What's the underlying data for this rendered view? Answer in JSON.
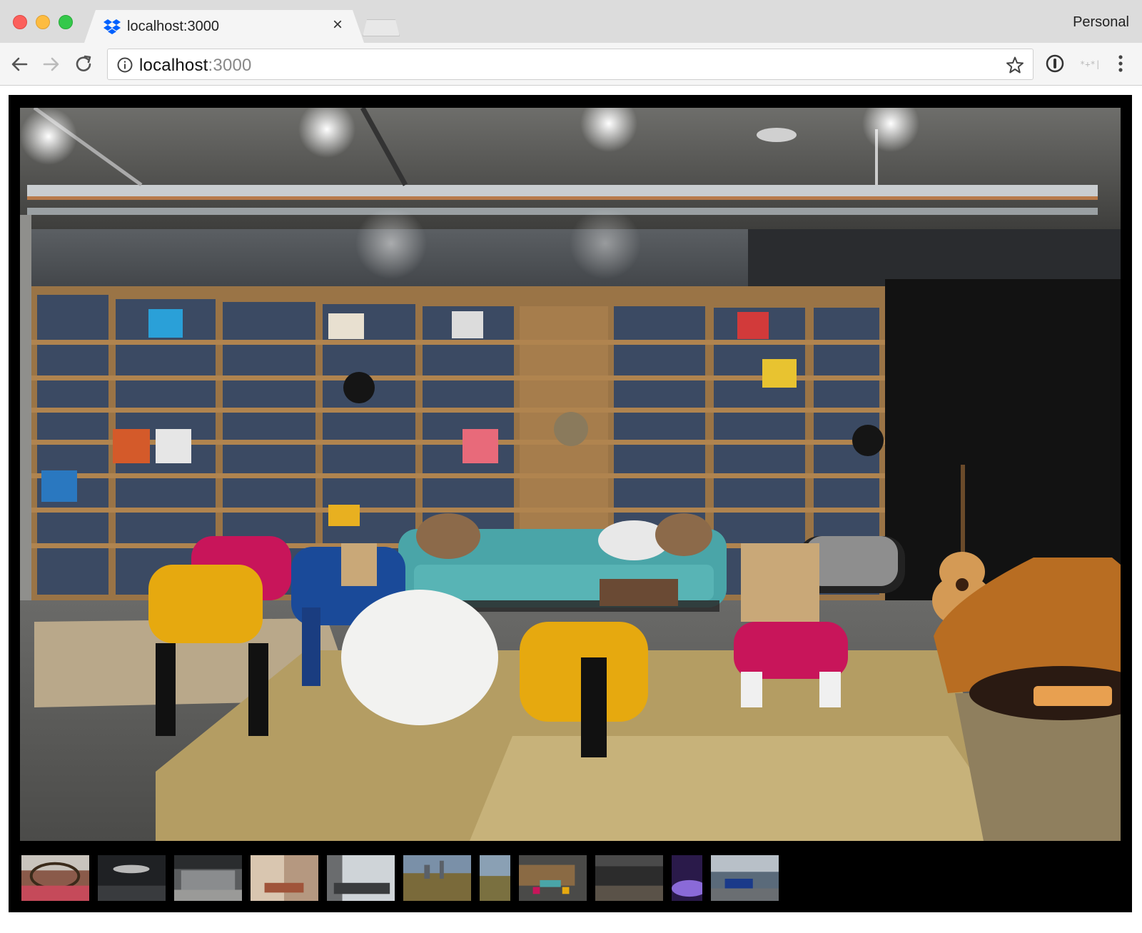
{
  "browser": {
    "tab": {
      "title": "localhost:3000",
      "favicon": "dropbox-icon",
      "close_glyph": "×"
    },
    "profile_label": "Personal",
    "toolbar": {
      "back_icon": "arrow-left-icon",
      "forward_icon": "arrow-right-icon",
      "reload_icon": "reload-icon",
      "url_host": "localhost",
      "url_port": ":3000",
      "info_icon": "info-icon",
      "bookmark_icon": "star-icon",
      "extensions": [
        "password-manager-icon",
        "extension-icon",
        "menu-dots-icon"
      ]
    }
  },
  "gallery": {
    "main_image": {
      "description_icon": "photo-lounge-library"
    },
    "thumbnails": [
      {
        "name": "thumb-1"
      },
      {
        "name": "thumb-2"
      },
      {
        "name": "thumb-3"
      },
      {
        "name": "thumb-4"
      },
      {
        "name": "thumb-5"
      },
      {
        "name": "thumb-6"
      },
      {
        "name": "thumb-7"
      },
      {
        "name": "thumb-8"
      },
      {
        "name": "thumb-9"
      },
      {
        "name": "thumb-10"
      },
      {
        "name": "thumb-11"
      }
    ],
    "selected_thumbnail": 8
  },
  "colors": {
    "tab_active": "#f5f5f5",
    "tabbar": "#dcdcdc",
    "viewer_bg": "#000000",
    "dropbox_blue": "#0061fe"
  }
}
